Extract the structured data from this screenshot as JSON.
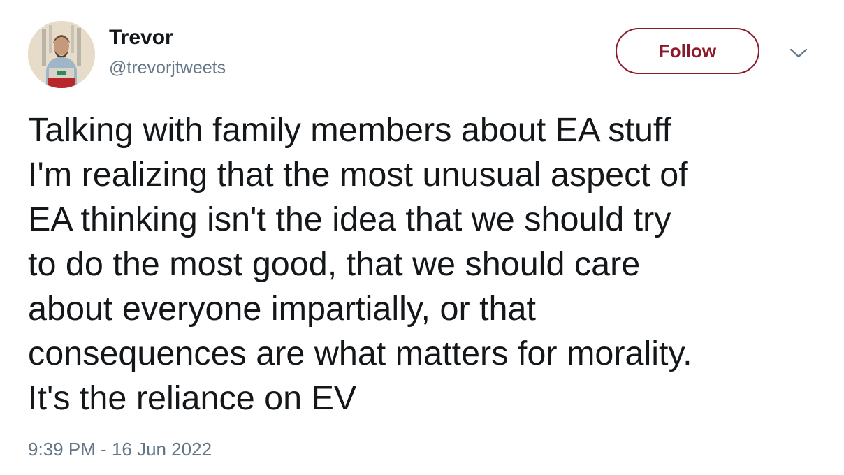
{
  "author": {
    "display_name": "Trevor",
    "handle": "@trevorjtweets"
  },
  "actions": {
    "follow_label": "Follow",
    "more_icon": "chevron-down-icon"
  },
  "tweet": {
    "text": "Talking with family members about EA stuff\nI'm realizing that the most unusual aspect of\nEA thinking isn't the idea that we should try\nto do the most good, that we should care\nabout everyone impartially, or that\nconsequences are what matters for morality.\nIt's the reliance on EV",
    "timestamp": "9:39 PM - 16 Jun 2022"
  },
  "colors": {
    "follow_accent": "#8b1a2b",
    "secondary_text": "#657786",
    "primary_text": "#14171a"
  }
}
